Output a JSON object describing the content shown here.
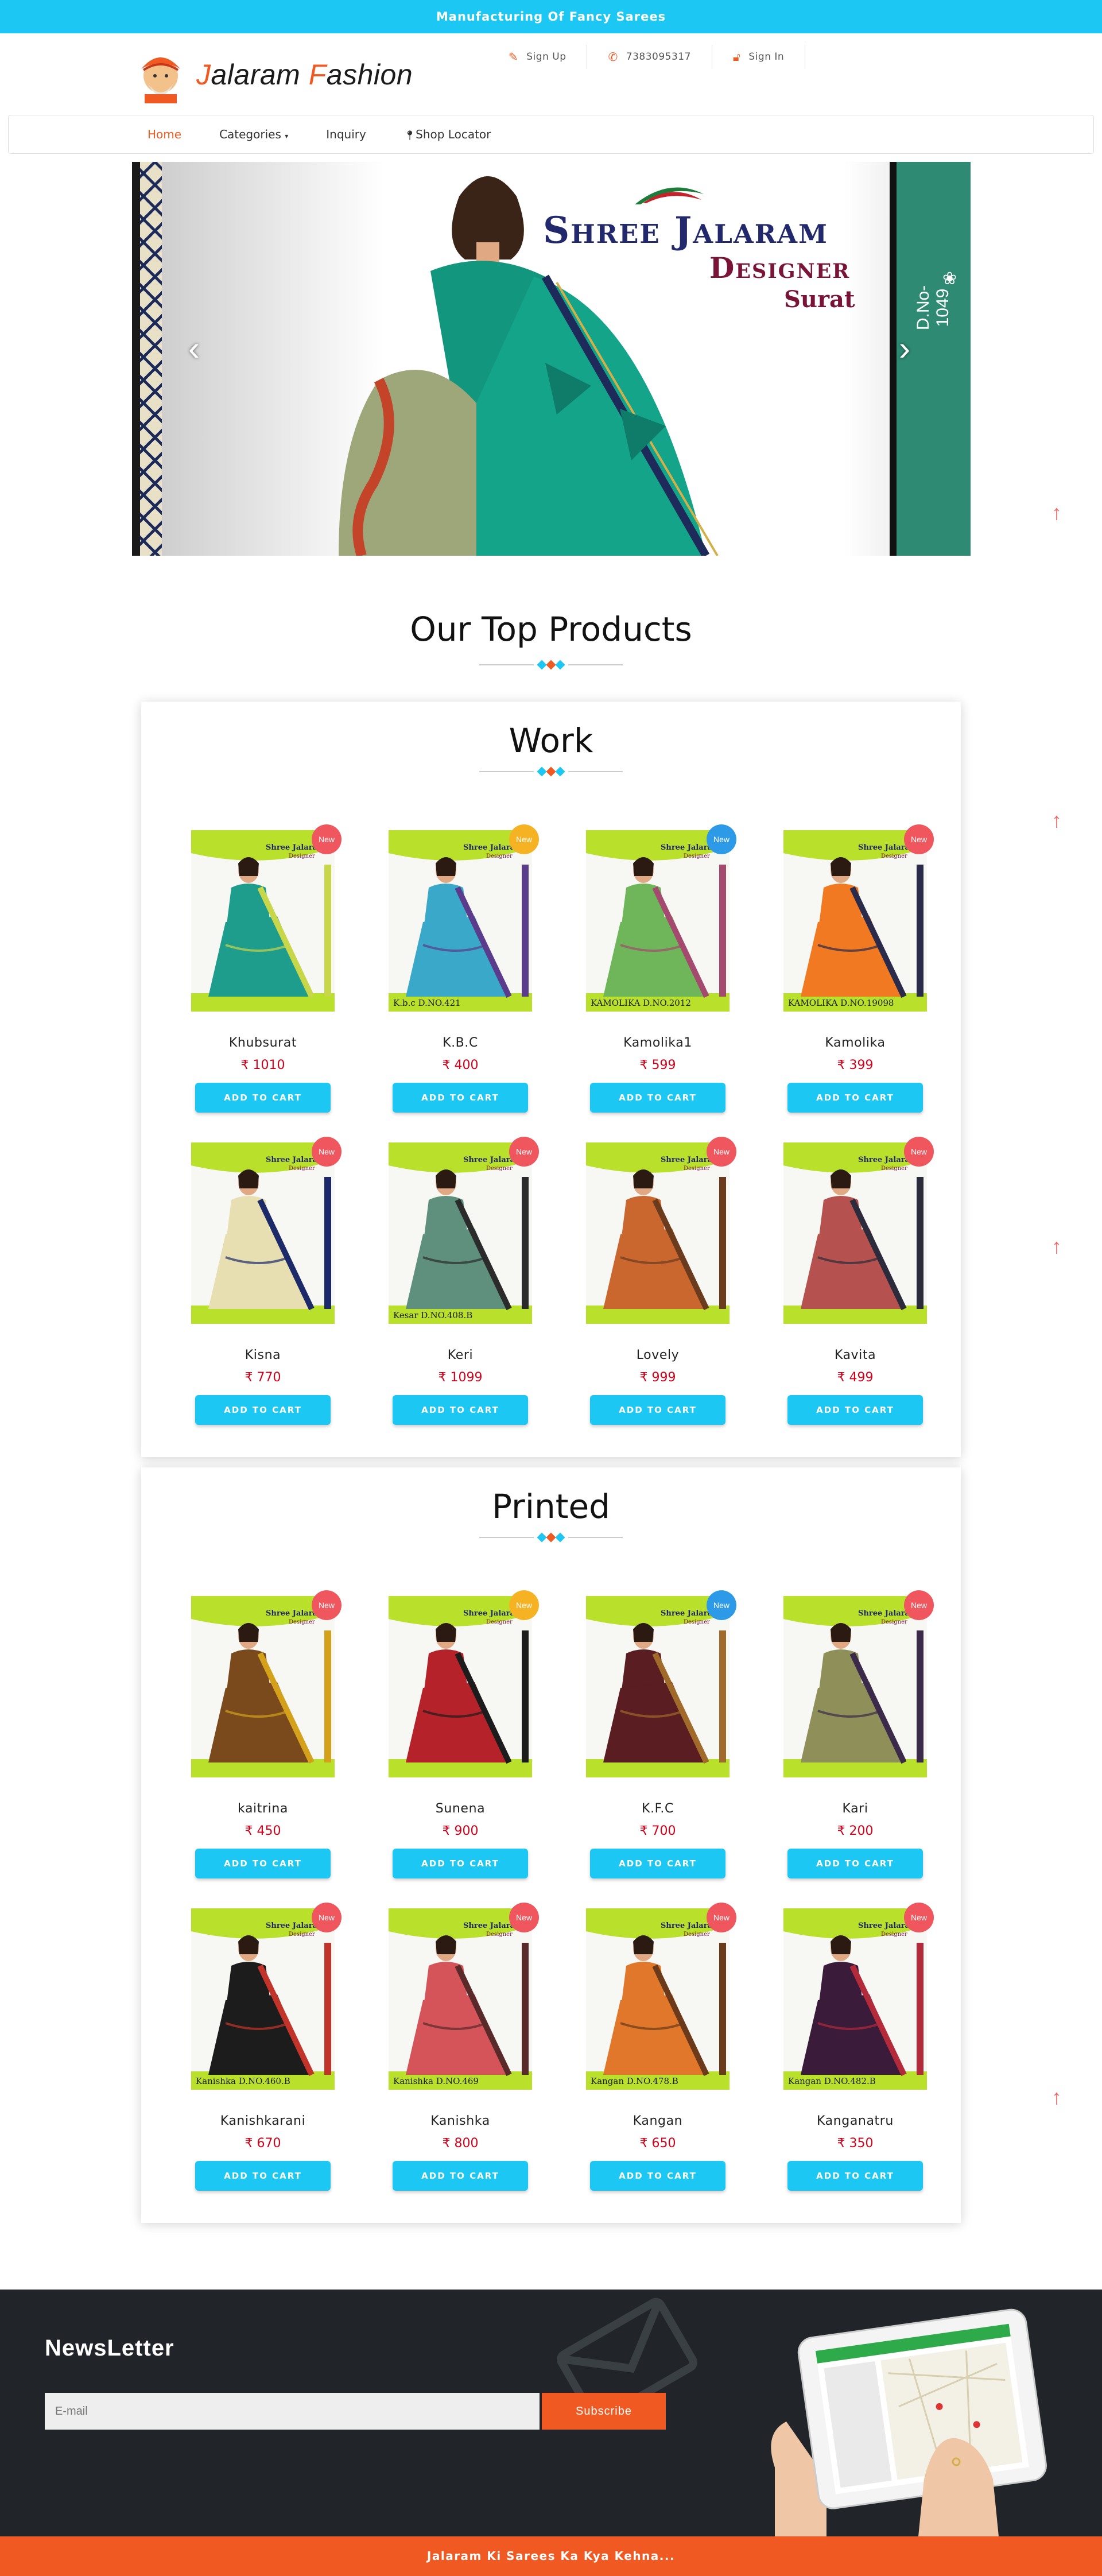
{
  "topbar": {
    "text": "Manufacturing Of Fancy Sarees"
  },
  "logo": {
    "first_initial": "J",
    "first_rest": "alaram ",
    "second_initial": "F",
    "second_rest": "ashion"
  },
  "header_links": [
    {
      "icon": "edit-icon",
      "label": "Sign Up"
    },
    {
      "icon": "phone-icon",
      "label": "7383095317"
    },
    {
      "icon": "lock-icon",
      "label": "Sign In"
    }
  ],
  "nav": {
    "items": [
      "Home",
      "Categories",
      "Inquiry",
      "Shop Locator"
    ],
    "active": "Home"
  },
  "slider": {
    "brand_line1": "Shree Jalaram",
    "brand_line2": "Designer",
    "brand_line3": "Surat",
    "side_label": "D.No-1049"
  },
  "top_products": {
    "title": "Our Top Products"
  },
  "sections": [
    {
      "title": "Work",
      "products": [
        {
          "name": "Khubsurat",
          "price": "₹ 1010",
          "badge": "New",
          "badge_color": "#f0565e",
          "saree": "#1e9c8c",
          "border": "#c8d64a",
          "caption": ""
        },
        {
          "name": "K.B.C",
          "price": "₹ 400",
          "badge": "New",
          "badge_color": "#f5b324",
          "saree": "#3aa9c9",
          "border": "#5a3b8c",
          "caption": "K.b.c   D.NO.421"
        },
        {
          "name": "Kamolika1",
          "price": "₹ 599",
          "badge": "New",
          "badge_color": "#2d9ae8",
          "saree": "#6fb65a",
          "border": "#a44a6e",
          "caption": "KAMOLIKA  D.NO.2012"
        },
        {
          "name": "Kamolika",
          "price": "₹ 399",
          "badge": "New",
          "badge_color": "#f0565e",
          "saree": "#f07922",
          "border": "#2a2a4a",
          "caption": "KAMOLIKA  D.NO.19098"
        },
        {
          "name": "Kisna",
          "price": "₹ 770",
          "badge": "New",
          "badge_color": "#f0565e",
          "saree": "#e7dfb1",
          "border": "#1c2a6a",
          "caption": ""
        },
        {
          "name": "Keri",
          "price": "₹ 1099",
          "badge": "New",
          "badge_color": "#f0565e",
          "saree": "#5f8f7d",
          "border": "#2b2b2b",
          "caption": "Kesar   D.NO.408.B"
        },
        {
          "name": "Lovely",
          "price": "₹ 999",
          "badge": "New",
          "badge_color": "#f0565e",
          "saree": "#c9672f",
          "border": "#6b3b1e",
          "caption": ""
        },
        {
          "name": "Kavita",
          "price": "₹ 499",
          "badge": "New",
          "badge_color": "#f0565e",
          "saree": "#b5524f",
          "border": "#2b2b3b",
          "caption": ""
        }
      ]
    },
    {
      "title": "Printed",
      "products": [
        {
          "name": "kaitrina",
          "price": "₹ 450",
          "badge": "New",
          "badge_color": "#f0565e",
          "saree": "#7a4a1c",
          "border": "#d4a21a",
          "caption": ""
        },
        {
          "name": "Sunena",
          "price": "₹ 900",
          "badge": "New",
          "badge_color": "#f5b324",
          "saree": "#b5222a",
          "border": "#1c1c1c",
          "caption": ""
        },
        {
          "name": "K.F.C",
          "price": "₹ 700",
          "badge": "New",
          "badge_color": "#2d9ae8",
          "saree": "#5a1d22",
          "border": "#a06a2a",
          "caption": ""
        },
        {
          "name": "Kari",
          "price": "₹ 200",
          "badge": "New",
          "badge_color": "#f0565e",
          "saree": "#8f8f5a",
          "border": "#3b2a4a",
          "caption": ""
        },
        {
          "name": "Kanishkarani",
          "price": "₹ 670",
          "badge": "New",
          "badge_color": "#f0565e",
          "saree": "#1c1c1c",
          "border": "#c2342a",
          "caption": "Kanishka   D.NO.460.B"
        },
        {
          "name": "Kanishka",
          "price": "₹ 800",
          "badge": "New",
          "badge_color": "#f0565e",
          "saree": "#d4545a",
          "border": "#5a2a2a",
          "caption": "Kanishka   D.NO.469"
        },
        {
          "name": "Kangan",
          "price": "₹ 650",
          "badge": "New",
          "badge_color": "#f0565e",
          "saree": "#e0772a",
          "border": "#6a3a1a",
          "caption": "Kangan   D.NO.478.B"
        },
        {
          "name": "Kanganatru",
          "price": "₹ 350",
          "badge": "New",
          "badge_color": "#f0565e",
          "saree": "#3a1c3a",
          "border": "#b32a3a",
          "caption": "Kangan   D.NO.482.B"
        }
      ]
    }
  ],
  "cart_label": "ADD TO CART",
  "newsletter": {
    "title": "NewsLetter",
    "placeholder": "E-mail",
    "button": "Subscribe"
  },
  "footer": {
    "text": "Jalaram Ki Sarees Ka Kya Kehna..."
  },
  "colors": {
    "accent": "#f05a22",
    "cyan": "#1dc7f3",
    "price": "#d0021b",
    "dark": "#212529"
  }
}
